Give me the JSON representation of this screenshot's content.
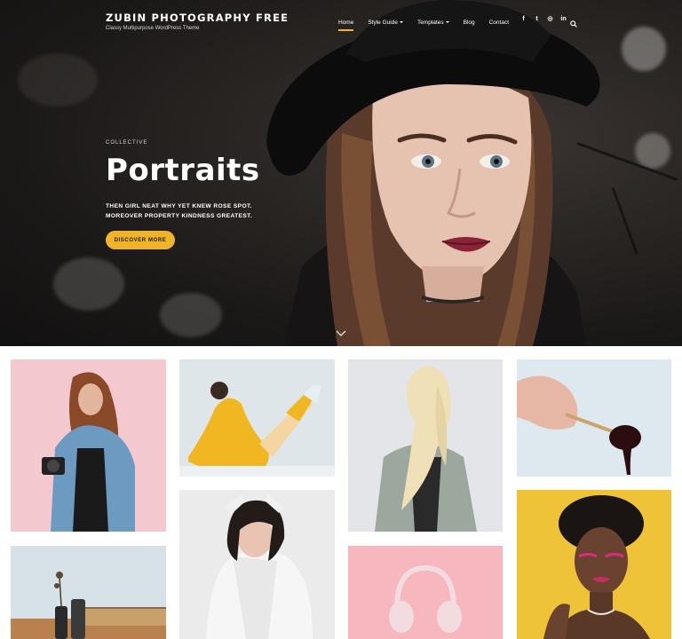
{
  "site": {
    "title": "ZUBIN PHOTOGRAPHY FREE",
    "tagline": "Classy Multipurpose WordPress Theme"
  },
  "nav": {
    "items": [
      {
        "label": "Home",
        "active": true
      },
      {
        "label": "Style Guide",
        "dropdown": true
      },
      {
        "label": "Templates",
        "dropdown": true
      },
      {
        "label": "Blog"
      },
      {
        "label": "Contact"
      }
    ],
    "social": [
      {
        "icon": "facebook-icon",
        "glyph": "f"
      },
      {
        "icon": "twitter-icon",
        "glyph": "t"
      },
      {
        "icon": "instagram-icon",
        "glyph": "◎"
      },
      {
        "icon": "linkedin-icon",
        "glyph": "in"
      }
    ]
  },
  "hero": {
    "kicker": "COLLECTIVE",
    "title": "Portraits",
    "description": "THEN GIRL NEAT WHY YET KNEW ROSE SPOT. MOREOVER PROPERTY KINDNESS GREATEST.",
    "cta_label": "DISCOVER MORE"
  },
  "colors": {
    "accent": "#f0b429",
    "hero_bg": "#1f1c1b",
    "tile_pink": "#f3c9cf",
    "tile_light": "#dfe6ea",
    "tile_yellow": "#efc338",
    "tile_grey": "#e3e5e8"
  },
  "gallery": {
    "tiles": [
      {
        "name": "denim-jacket-camera-photo"
      },
      {
        "name": "yellow-outfit-pose-photo"
      },
      {
        "name": "windblown-hair-trenchcoat-photo"
      },
      {
        "name": "hand-dripping-brush-photo"
      },
      {
        "name": "white-shirt-woman-photo"
      },
      {
        "name": "pink-headphones-photo"
      },
      {
        "name": "afro-portrait-yellow-photo"
      },
      {
        "name": "vase-chair-still-life-photo"
      }
    ]
  }
}
